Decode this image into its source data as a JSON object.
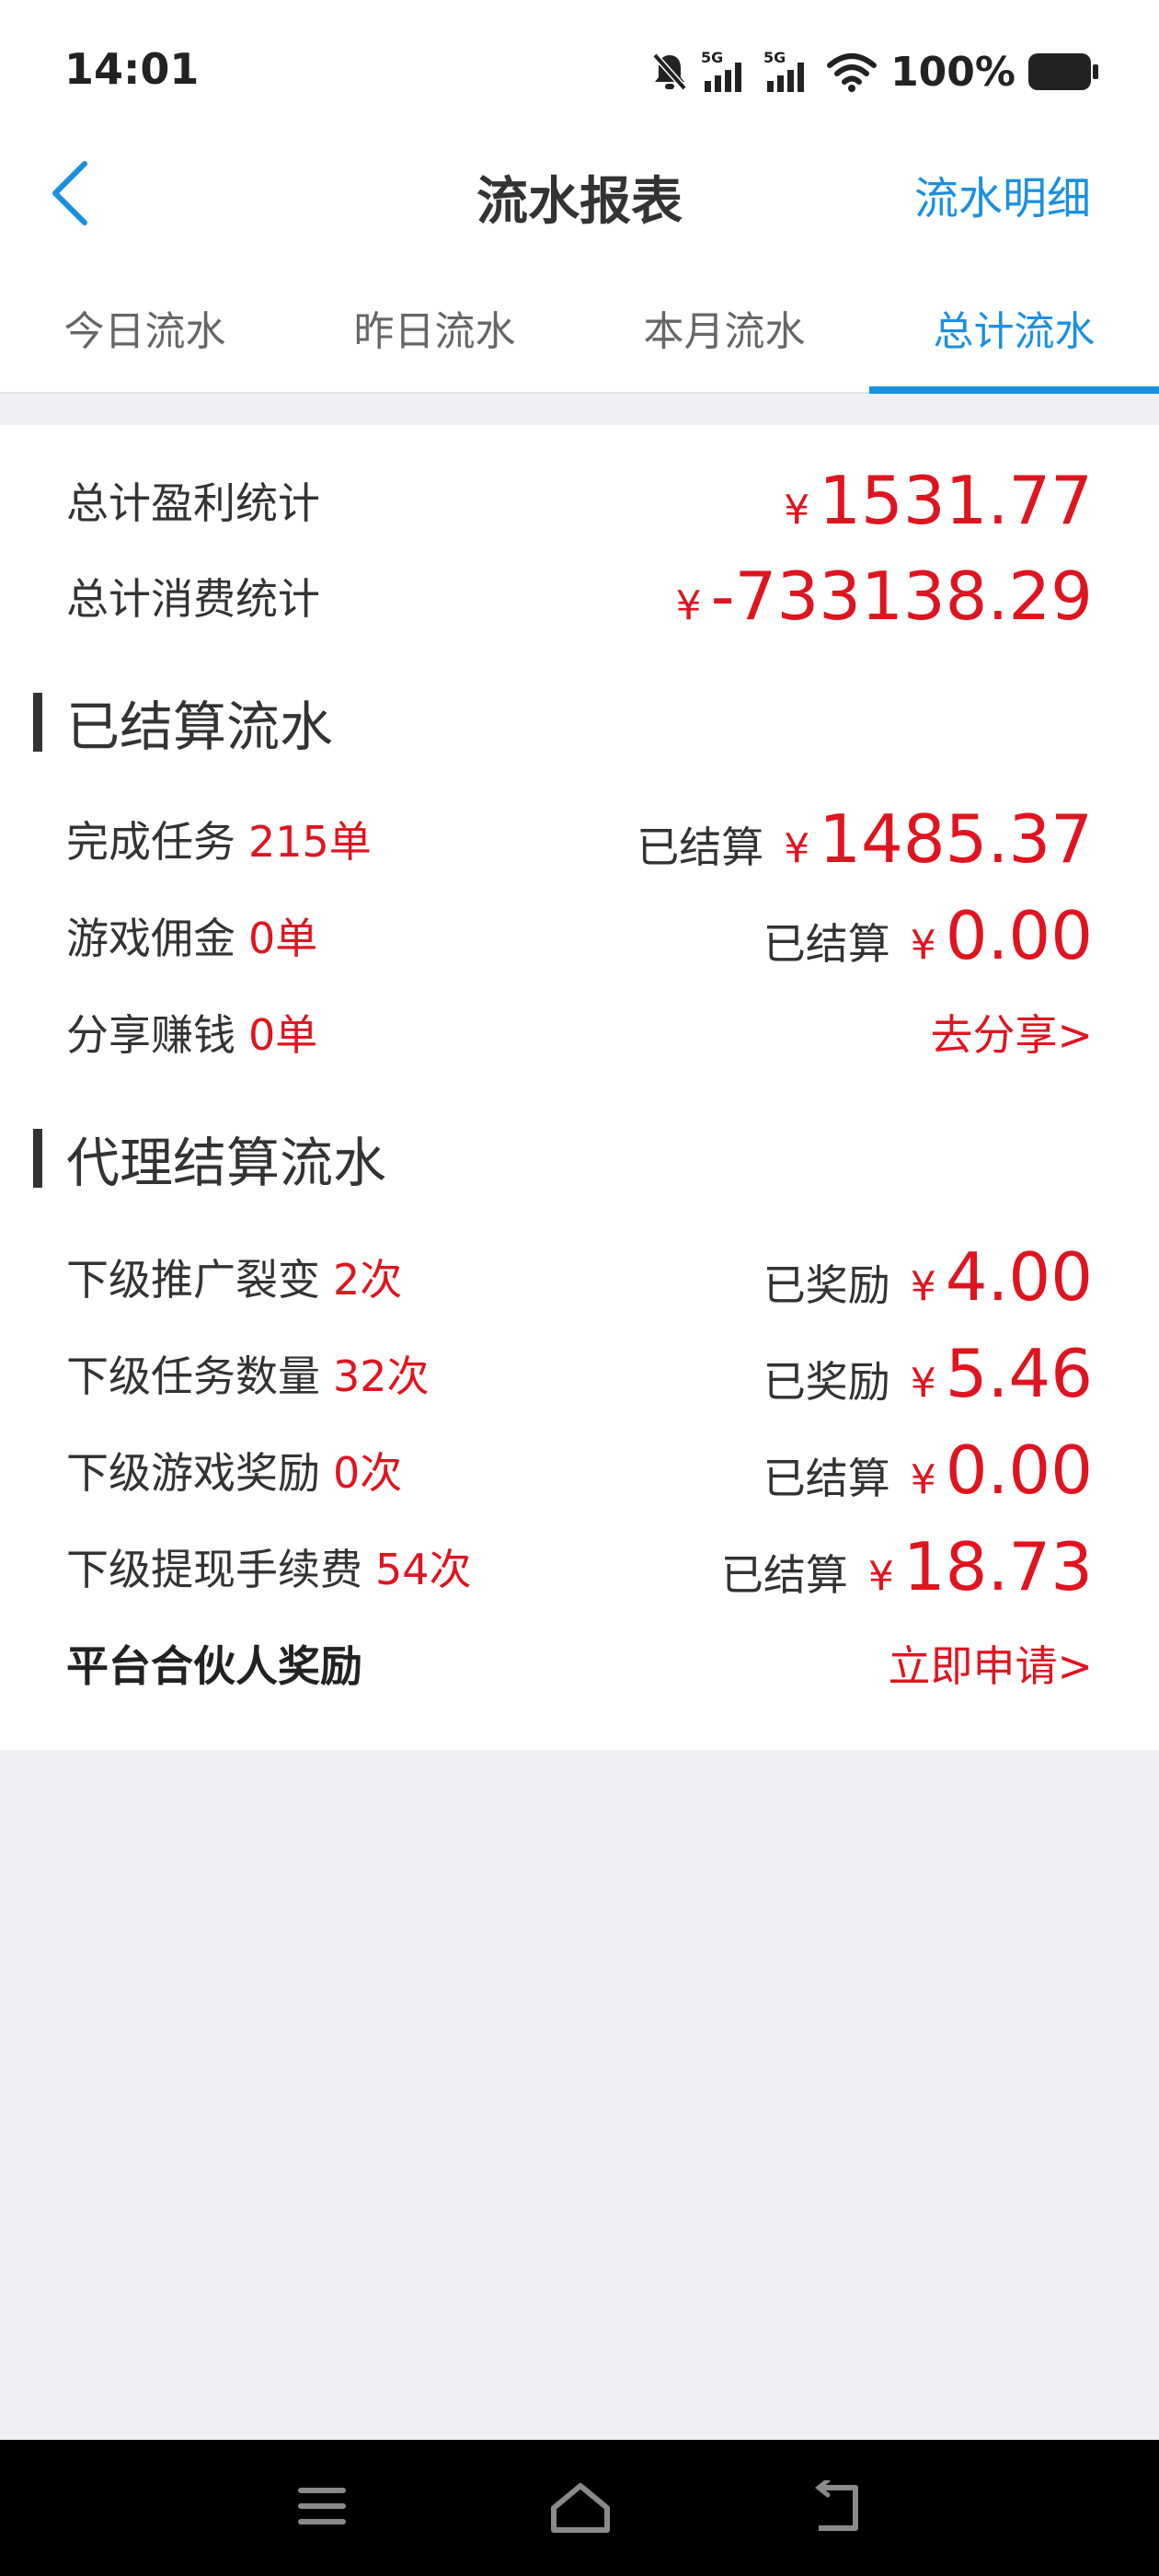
{
  "status_bar": {
    "time": "14:01",
    "network_1": "5G",
    "network_2": "5G",
    "battery": "100%"
  },
  "nav": {
    "title": "流水报表",
    "action": "流水明细"
  },
  "tabs": [
    {
      "label": "今日流水",
      "active": false
    },
    {
      "label": "昨日流水",
      "active": false
    },
    {
      "label": "本月流水",
      "active": false
    },
    {
      "label": "总计流水",
      "active": true
    }
  ],
  "summary": {
    "profit_label": "总计盈利统计",
    "profit_currency": "¥",
    "profit_value": "1531.77",
    "spend_label": "总计消费统计",
    "spend_currency": "¥",
    "spend_value": "-733138.29"
  },
  "settled_section": {
    "title": "已结算流水",
    "rows": [
      {
        "label": "完成任务",
        "count": "215单",
        "status": "已结算",
        "currency": "¥",
        "amount": "1485.37"
      },
      {
        "label": "游戏佣金",
        "count": "0单",
        "status": "已结算",
        "currency": "¥",
        "amount": "0.00"
      },
      {
        "label": "分享赚钱",
        "count": "0单",
        "link": "去分享>"
      }
    ]
  },
  "agent_section": {
    "title": "代理结算流水",
    "rows": [
      {
        "label": "下级推广裂变",
        "count": "2次",
        "status": "已奖励",
        "currency": "¥",
        "amount": "4.00"
      },
      {
        "label": "下级任务数量",
        "count": "32次",
        "status": "已奖励",
        "currency": "¥",
        "amount": "5.46"
      },
      {
        "label": "下级游戏奖励",
        "count": "0次",
        "status": "已结算",
        "currency": "¥",
        "amount": "0.00"
      },
      {
        "label": "下级提现手续费",
        "count": "54次",
        "status": "已结算",
        "currency": "¥",
        "amount": "18.73"
      },
      {
        "label": "平台合伙人奖励",
        "link": "立即申请>"
      }
    ]
  },
  "colors": {
    "accent": "#1a90e0",
    "money": "#e0141e",
    "background": "#efeff4"
  }
}
